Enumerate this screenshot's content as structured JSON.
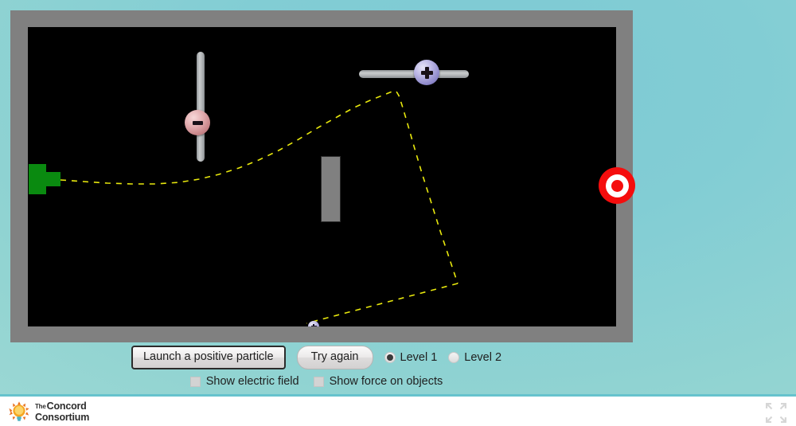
{
  "theme": {
    "background_top": "#7ec9d4",
    "background_bottom": "#a6dcd6",
    "stage_background": "#000000",
    "frame_color": "#808080",
    "trajectory_color": "#e8e80d",
    "launcher_color": "#0a8a10",
    "target_color": "#f50d0d",
    "obstacle_color": "#808080",
    "negative_charge_color": "#e3aeb1",
    "positive_charge_color": "#b9b4e4"
  },
  "simulation": {
    "name": "electric-field-particle-launcher",
    "negative_slider": {
      "name": "negative-charge-vertical-slider",
      "orientation": "vertical",
      "handle_sign": "−",
      "handle_label": "minus"
    },
    "positive_slider": {
      "name": "positive-charge-horizontal-slider",
      "orientation": "horizontal",
      "handle_sign": "+",
      "handle_label": "plus"
    },
    "launcher": {
      "label": "particle-launcher"
    },
    "obstacle": {
      "label": "wall-obstacle"
    },
    "target": {
      "label": "bullseye-target"
    },
    "particle": {
      "label": "positive-particle",
      "sign": "+"
    },
    "trajectory": {
      "label": "particle-trajectory",
      "style": "dashed",
      "points": [
        [
          41,
          192
        ],
        [
          70,
          194
        ],
        [
          100,
          196
        ],
        [
          130,
          197
        ],
        [
          160,
          197
        ],
        [
          190,
          195
        ],
        [
          215,
          191
        ],
        [
          240,
          185
        ],
        [
          265,
          177
        ],
        [
          290,
          167
        ],
        [
          315,
          155
        ],
        [
          340,
          141
        ],
        [
          365,
          126
        ],
        [
          390,
          112
        ],
        [
          410,
          101
        ],
        [
          430,
          92
        ],
        [
          445,
          86
        ],
        [
          455,
          82
        ],
        [
          460,
          80
        ],
        [
          463,
          81
        ],
        [
          466,
          86
        ],
        [
          470,
          98
        ],
        [
          476,
          118
        ],
        [
          484,
          146
        ],
        [
          494,
          180
        ],
        [
          506,
          218
        ],
        [
          518,
          256
        ],
        [
          530,
          292
        ],
        [
          540,
          322
        ],
        [
          350,
          372
        ]
      ]
    }
  },
  "controls": {
    "launch_button": "Launch a positive particle",
    "try_again_button": "Try again",
    "levels": [
      {
        "label": "Level 1",
        "selected": true
      },
      {
        "label": "Level 2",
        "selected": false
      }
    ],
    "checkboxes": [
      {
        "label": "Show electric field",
        "checked": false
      },
      {
        "label": "Show force on objects",
        "checked": false
      }
    ]
  },
  "footer": {
    "logo": {
      "the": "The",
      "line1": "Concord",
      "line2": "Consortium",
      "icon": "lightbulb-sun-logo"
    },
    "corner_icons": [
      {
        "name": "expand-fullscreen-icon"
      },
      {
        "name": "collapse-fullscreen-icon"
      }
    ]
  }
}
